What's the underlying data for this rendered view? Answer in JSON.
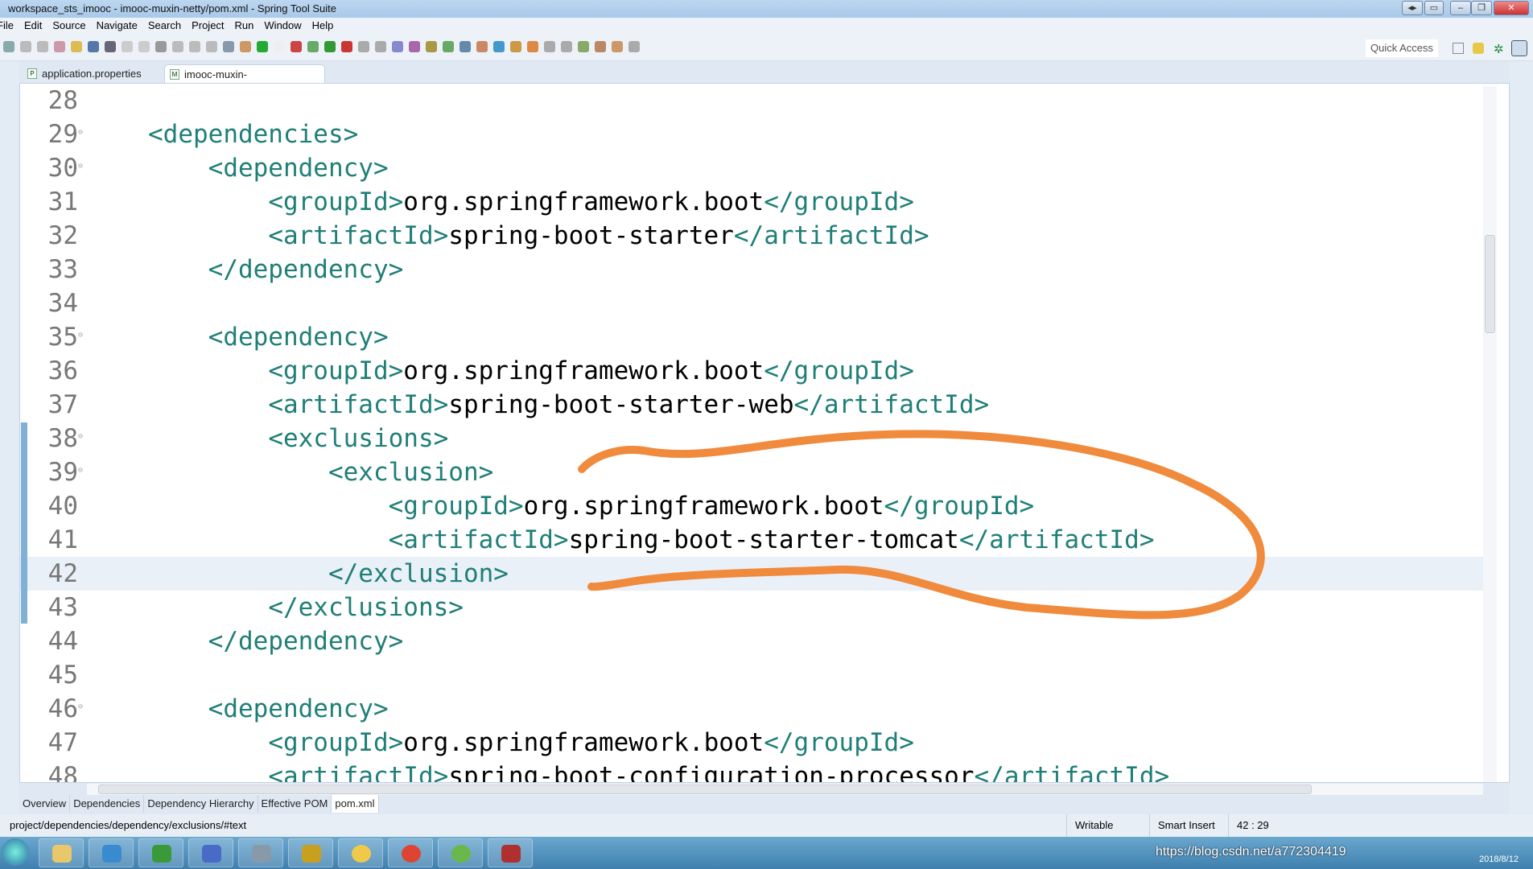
{
  "window": {
    "title": "workspace_sts_imooc - imooc-muxin-netty/pom.xml - Spring Tool Suite"
  },
  "menu": [
    "File",
    "Edit",
    "Source",
    "Navigate",
    "Search",
    "Project",
    "Run",
    "Window",
    "Help"
  ],
  "toolbar": {
    "quick_access": "Quick Access"
  },
  "editor_tabs": [
    {
      "label": "application.properties",
      "icon": "properties-file-icon",
      "active": false
    },
    {
      "label": "imooc-muxin-netty/pom.xml",
      "icon": "maven-pom-icon",
      "active": true,
      "close": "✕"
    }
  ],
  "code": {
    "current_line": 42,
    "fold_lines": [
      29,
      30,
      35,
      38,
      39,
      46
    ],
    "lines": [
      {
        "n": "28",
        "text": ""
      },
      {
        "n": "29",
        "text": "<dependencies>"
      },
      {
        "n": "30",
        "text": "    <dependency>"
      },
      {
        "n": "31",
        "text": "        <groupId>org.springframework.boot</groupId>"
      },
      {
        "n": "32",
        "text": "        <artifactId>spring-boot-starter</artifactId>"
      },
      {
        "n": "33",
        "text": "    </dependency>"
      },
      {
        "n": "34",
        "text": ""
      },
      {
        "n": "35",
        "text": "    <dependency>"
      },
      {
        "n": "36",
        "text": "        <groupId>org.springframework.boot</groupId>"
      },
      {
        "n": "37",
        "text": "        <artifactId>spring-boot-starter-web</artifactId>"
      },
      {
        "n": "38",
        "text": "        <exclusions>"
      },
      {
        "n": "39",
        "text": "            <exclusion>"
      },
      {
        "n": "40",
        "text": "                <groupId>org.springframework.boot</groupId>"
      },
      {
        "n": "41",
        "text": "                <artifactId>spring-boot-starter-tomcat</artifactId>"
      },
      {
        "n": "42",
        "text": "            </exclusion>"
      },
      {
        "n": "43",
        "text": "        </exclusions>"
      },
      {
        "n": "44",
        "text": "    </dependency>"
      },
      {
        "n": "45",
        "text": ""
      },
      {
        "n": "46",
        "text": "    <dependency>"
      },
      {
        "n": "47",
        "text": "        <groupId>org.springframework.boot</groupId>"
      },
      {
        "n": "48",
        "text": "        <artifactId>spring-boot-configuration-processor</artifactId>"
      }
    ]
  },
  "colors": {
    "tag": "#1f7f77",
    "text": "#000000",
    "annotation": "#f08a3c",
    "current_line": "#e9f0f8"
  },
  "bottom_tabs": [
    "Overview",
    "Dependencies",
    "Dependency Hierarchy",
    "Effective POM",
    "pom.xml"
  ],
  "status": {
    "path": "project/dependencies/dependency/exclusions/#text",
    "writable": "Writable",
    "insert_mode": "Smart Insert",
    "position": "42 : 29"
  },
  "taskbar": {
    "watermark": "https://blog.csdn.net/a772304419",
    "date": "2018/8/12"
  }
}
